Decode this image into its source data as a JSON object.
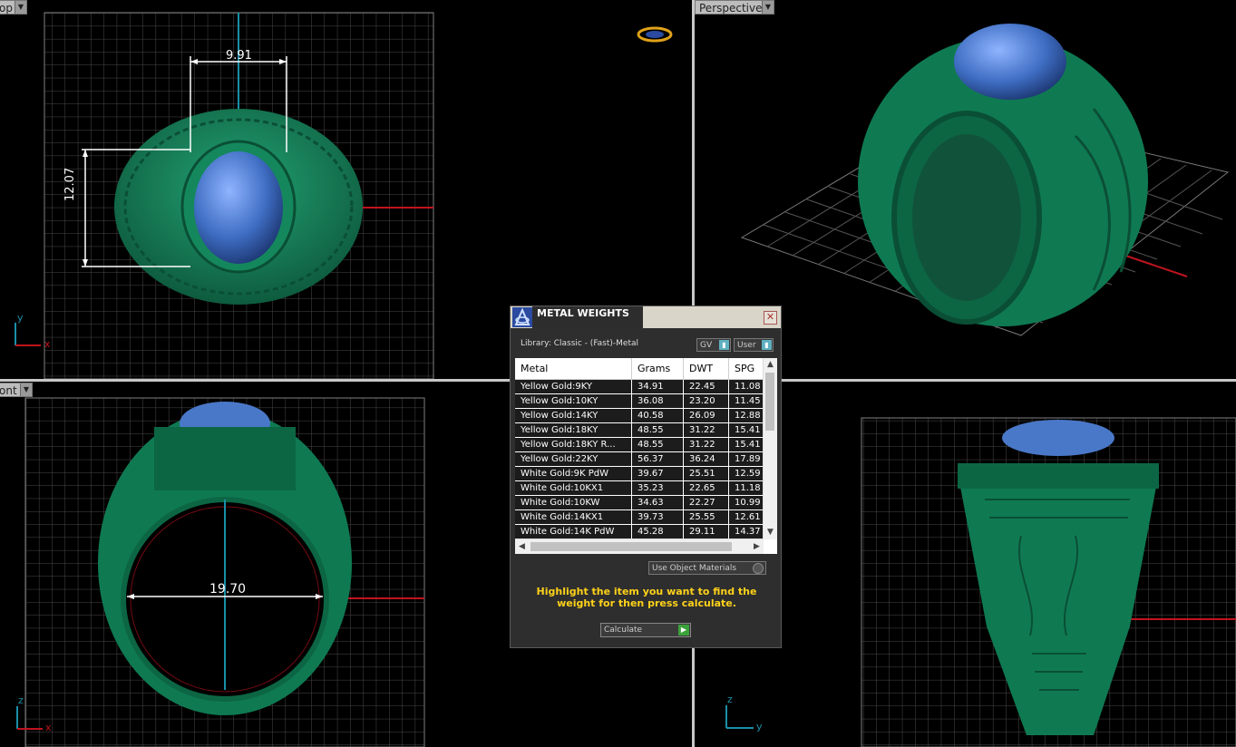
{
  "viewports": {
    "top": {
      "label": "op",
      "dimension_width": "9.91",
      "dimension_height": "12.07",
      "axis_x": "x",
      "axis_y": "y"
    },
    "perspective": {
      "label": "Perspective"
    },
    "front": {
      "label": "ont",
      "dimension_diameter": "19.70",
      "axis_x": "x",
      "axis_z": "z"
    },
    "right": {
      "axis_y": "y",
      "axis_z": "z"
    }
  },
  "dialog": {
    "title": "METAL WEIGHTS",
    "close_glyph": "✕",
    "library_label": "Library: Classic - (Fast)-Metal",
    "combo_gv": "GV",
    "combo_user": "User",
    "columns": [
      "Metal",
      "Grams",
      "DWT",
      "SPG"
    ],
    "rows": [
      [
        "Yellow Gold:9KY",
        "34.91",
        "22.45",
        "11.08"
      ],
      [
        "Yellow Gold:10KY",
        "36.08",
        "23.20",
        "11.45"
      ],
      [
        "Yellow Gold:14KY",
        "40.58",
        "26.09",
        "12.88"
      ],
      [
        "Yellow Gold:18KY",
        "48.55",
        "31.22",
        "15.41"
      ],
      [
        "Yellow Gold:18KY R...",
        "48.55",
        "31.22",
        "15.41"
      ],
      [
        "Yellow Gold:22KY",
        "56.37",
        "36.24",
        "17.89"
      ],
      [
        "White Gold:9K PdW",
        "39.67",
        "25.51",
        "12.59"
      ],
      [
        "White Gold:10KX1",
        "35.23",
        "22.65",
        "11.18"
      ],
      [
        "White Gold:10KW",
        "34.63",
        "22.27",
        "10.99"
      ],
      [
        "White Gold:14KX1",
        "39.73",
        "25.55",
        "12.61"
      ],
      [
        "White Gold:14K PdW",
        "45.28",
        "29.11",
        "14.37"
      ]
    ],
    "use_object_materials": "Use Object Materials",
    "hint": "Highlight the item you want to find the weight for then press calculate.",
    "calculate_label": "Calculate"
  },
  "colors": {
    "ring": "#0f7a52",
    "stone": "#4a78c8",
    "grid": "#5a5a5a",
    "hint": "#ffd21a"
  }
}
